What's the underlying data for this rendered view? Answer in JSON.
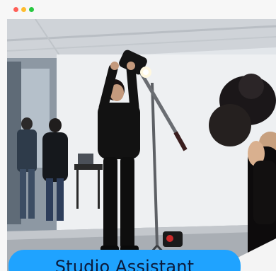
{
  "window": {
    "controls": [
      "close",
      "minimize",
      "maximize"
    ]
  },
  "colors": {
    "close": "#ff5f57",
    "minimize": "#febc2e",
    "maximize": "#28c840",
    "pill": "#1fa3ff",
    "pill_text": "#0b1a3a"
  },
  "photo": {
    "icon": "studio-photo"
  },
  "job": {
    "title": "Studio Assistant"
  }
}
